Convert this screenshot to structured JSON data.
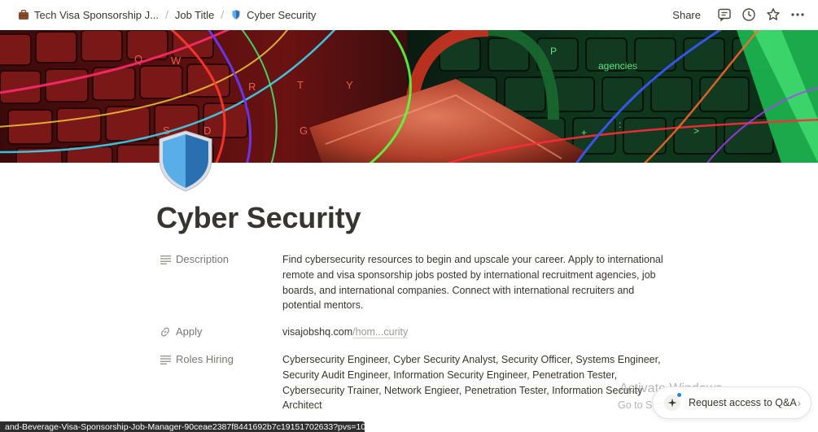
{
  "breadcrumb": {
    "items": [
      {
        "label": "Tech Visa Sponsorship J...",
        "icon": "briefcase-icon"
      },
      {
        "label": "Job Title"
      },
      {
        "label": "Cyber Security",
        "icon": "shield-icon"
      }
    ],
    "separator": "/"
  },
  "topbar": {
    "share_label": "Share",
    "icons": [
      "comment-icon",
      "history-clock-icon",
      "favorite-star-icon",
      "more-options-icon"
    ]
  },
  "page": {
    "title": "Cyber Security",
    "icon": "shield-icon"
  },
  "properties": {
    "description": {
      "name": "Description",
      "icon": "text-lines-icon",
      "value": "Find cybersecurity resources to begin and upscale your career. Apply to international remote and visa sponsorship jobs posted by international recruitment agencies, job boards, and international companies. Connect with international recruiters and potential mentors."
    },
    "apply": {
      "name": "Apply",
      "icon": "link-icon",
      "domain": "visajobshq.com",
      "path": "/hom...curity"
    },
    "roles_hiring": {
      "name": "Roles Hiring",
      "icon": "text-lines-icon",
      "value": "Cybersecurity Engineer, Cyber Security Analyst, Security Officer, Systems Engineer, Security Audit Engineer, Information Security Engineer, Penetration Tester, Cybersecurity Trainer, Network Engieer, Penetration Tester, Information Security Architect"
    }
  },
  "status_url": "and-Beverage-Visa-Sponsorship-Job-Manager-90ceae2387f8441692b7c19151702633?pvs=10",
  "watermark": {
    "line1": "Activate Windows",
    "line2": "Go to Settings to activate Windows."
  },
  "request_access": {
    "label": "Request access to Q&A",
    "icon": "sparkle-icon"
  },
  "colors": {
    "text": "#37352f",
    "muted": "#787774",
    "shield_light": "#5aaee8",
    "shield_dark": "#2a6fb0"
  }
}
